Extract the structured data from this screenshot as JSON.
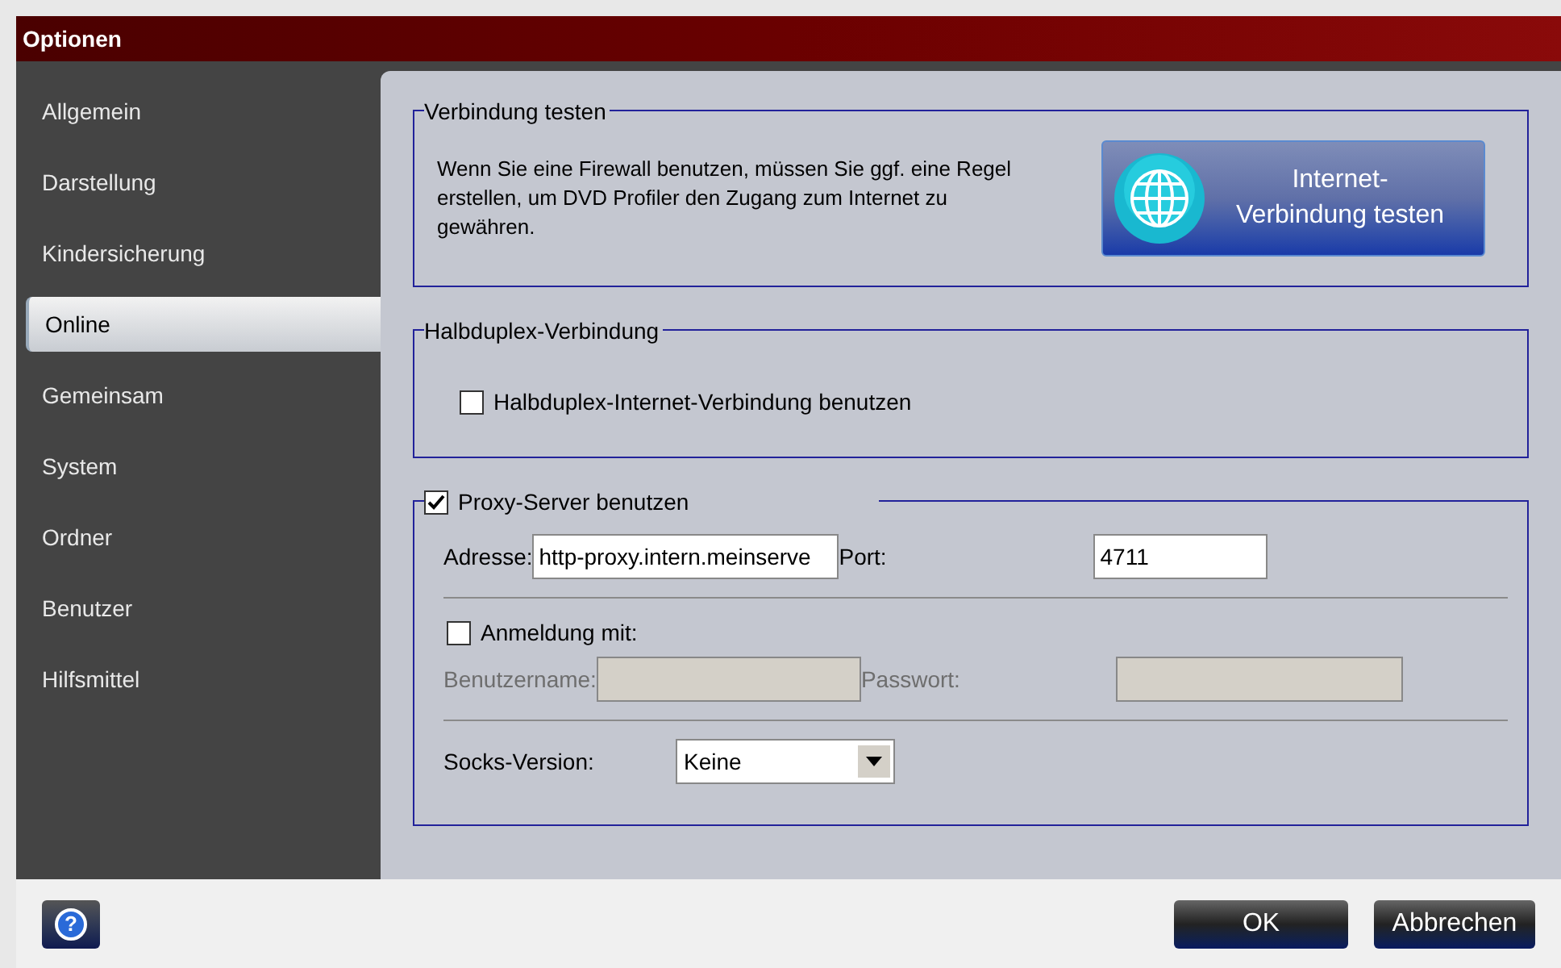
{
  "window": {
    "title": "Optionen"
  },
  "sidebar": {
    "items": [
      {
        "label": "Allgemein",
        "selected": false
      },
      {
        "label": "Darstellung",
        "selected": false
      },
      {
        "label": "Kindersicherung",
        "selected": false
      },
      {
        "label": "Online",
        "selected": true
      },
      {
        "label": "Gemeinsam",
        "selected": false
      },
      {
        "label": "System",
        "selected": false
      },
      {
        "label": "Ordner",
        "selected": false
      },
      {
        "label": "Benutzer",
        "selected": false
      },
      {
        "label": "Hilfsmittel",
        "selected": false
      }
    ]
  },
  "test_group": {
    "title": "Verbindung testen",
    "text": "Wenn Sie eine Firewall benutzen, müssen Sie ggf. eine Regel erstellen, um DVD Profiler den Zugang zum Internet zu gewähren.",
    "button_lines": [
      "Internet-",
      "Verbindung testen"
    ]
  },
  "halfduplex_group": {
    "title": "Halbduplex-Verbindung",
    "checkbox": {
      "label": "Halbduplex-Internet-Verbindung benutzen",
      "checked": false
    }
  },
  "proxy_group": {
    "checkbox": {
      "label": "Proxy-Server benutzen",
      "checked": true
    },
    "address": {
      "label": "Adresse:",
      "value": "http-proxy.intern.meinserve"
    },
    "port": {
      "label": "Port:",
      "value": "4711"
    },
    "login": {
      "label": "Anmeldung mit:",
      "checked": false
    },
    "username": {
      "label": "Benutzername:",
      "disabled": true
    },
    "password": {
      "label": "Passwort:",
      "disabled": true
    },
    "socks": {
      "label": "Socks-Version:",
      "value": "Keine"
    }
  },
  "footer": {
    "help": "?",
    "buttons": [
      "OK",
      "Abbrechen"
    ]
  }
}
